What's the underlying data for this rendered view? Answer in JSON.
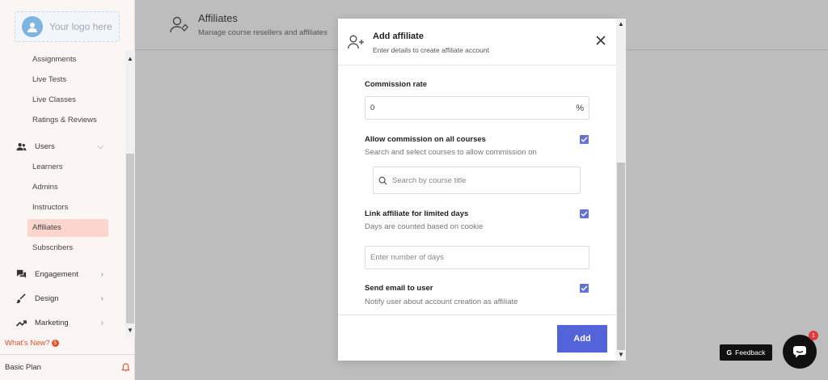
{
  "sidebar": {
    "logo_text": "Your logo here",
    "sub_items_top": [
      "Assignments",
      "Live Tests",
      "Live Classes",
      "Ratings & Reviews"
    ],
    "users_label": "Users",
    "users_sub": [
      "Learners",
      "Admins",
      "Instructors",
      "Affiliates",
      "Subscribers"
    ],
    "active_item": "Affiliates",
    "engagement_label": "Engagement",
    "design_label": "Design",
    "marketing_label": "Marketing",
    "whats_new_label": "What's New?",
    "whats_new_count": "5",
    "plan_label": "Basic Plan"
  },
  "page": {
    "title": "Affiliates",
    "subtitle": "Manage course resellers and affiliates"
  },
  "modal": {
    "title": "Add affiliate",
    "subtitle": "Enter details to create affiliate account",
    "commission_label": "Commission rate",
    "commission_value": "0",
    "commission_unit": "%",
    "allow_all_label": "Allow commission on all courses",
    "allow_all_help": "Search and select courses to allow commission on",
    "allow_all_checked": true,
    "search_placeholder": "Search by course title",
    "limited_days_label": "Link affiliate for limited days",
    "limited_days_help": "Days are counted based on cookie",
    "limited_days_checked": true,
    "days_placeholder": "Enter number of days",
    "send_email_label": "Send email to user",
    "send_email_help": "Notify user about account creation as affiliate",
    "send_email_checked": true,
    "add_button": "Add"
  },
  "widgets": {
    "feedback_label": "Feedback",
    "chat_badge": "1"
  },
  "colors": {
    "accent": "#5364db",
    "active_bg": "#fcd6cc",
    "whats_new": "#e0522d"
  }
}
